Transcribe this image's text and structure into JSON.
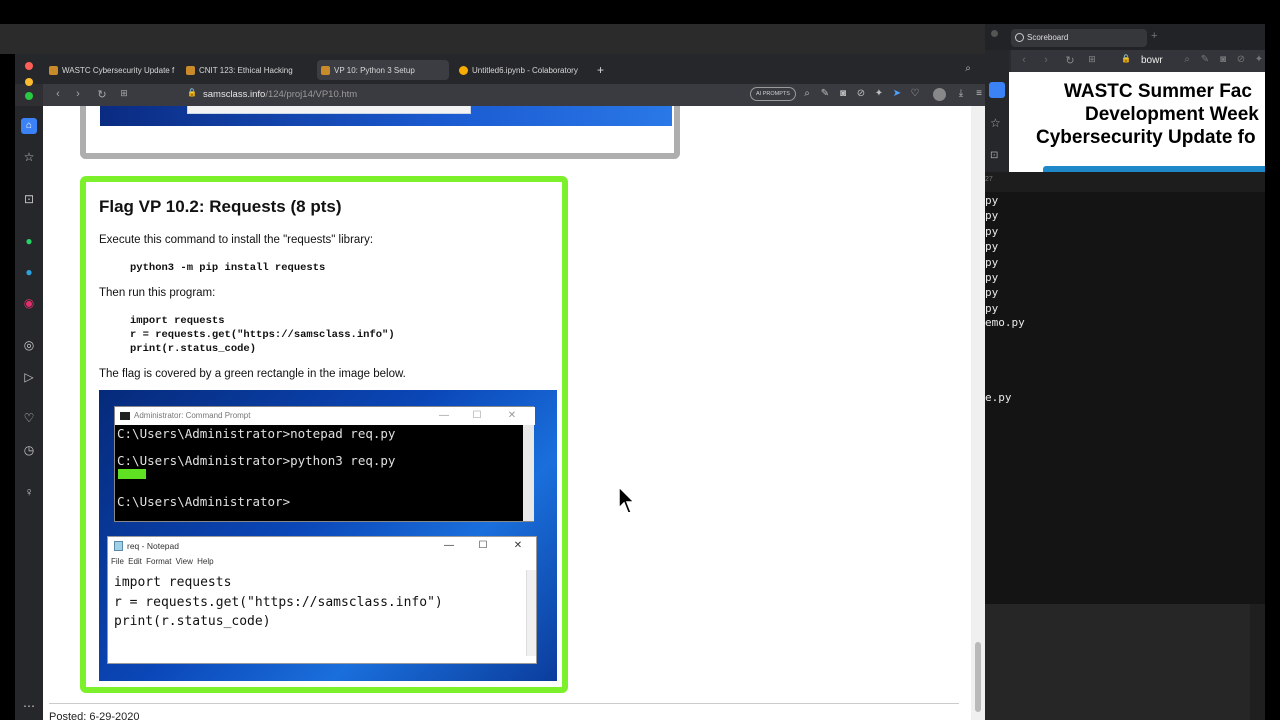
{
  "main_browser": {
    "tabs": [
      {
        "label": "WASTC Cybersecurity Update f",
        "active": false
      },
      {
        "label": "CNIT 123: Ethical Hacking",
        "active": false
      },
      {
        "label": "VP 10: Python 3 Setup",
        "active": true
      },
      {
        "label": "Untitled6.ipynb - Colaboratory",
        "active": false
      }
    ],
    "new_tab": "+",
    "url_domain": "samsclass.info",
    "url_path": "/124/proj14/VP10.htm",
    "ai_prompts_label": "AI PROMPTS"
  },
  "page": {
    "flag_title": "Flag VP 10.2: Requests (8 pts)",
    "p1": "Execute this command to install the \"requests\" library:",
    "cmd1": "python3 -m pip install requests",
    "p2": "Then run this program:",
    "code_lines": [
      "import requests",
      "r = requests.get(\"https://samsclass.info\")",
      "print(r.status_code)"
    ],
    "p3": "The flag is covered by a green rectangle in the image below.",
    "screenshot": {
      "cmd_title": "Administrator: Command Prompt",
      "cmd_lines": [
        "C:\\Users\\Administrator>notepad req.py",
        "C:\\Users\\Administrator>python3 req.py",
        "C:\\Users\\Administrator>"
      ],
      "notepad_title": "req - Notepad",
      "notepad_menu": "File  Edit  Format  View  Help",
      "notepad_text": "import requests\nr = requests.get(\"https://samsclass.info\")\nprint(r.status_code)",
      "flag_cover_color": "#5fe023"
    },
    "posted": "Posted: 6-29-2020"
  },
  "right_browser": {
    "tab_label": "Scoreboard",
    "address_text": "bowr",
    "heading_lines": [
      "WASTC Summer Fac",
      "Development Week",
      "Cybersecurity Update fo"
    ]
  },
  "terminal": {
    "header": "27",
    "lines": [
      "py",
      "py",
      "py",
      "py",
      "py",
      "py",
      "py",
      "py",
      "emo.py",
      "",
      "",
      "",
      "",
      "e.py"
    ]
  },
  "colors": {
    "flag_border": "#7cf02a",
    "accent_blue": "#1e88c8"
  }
}
